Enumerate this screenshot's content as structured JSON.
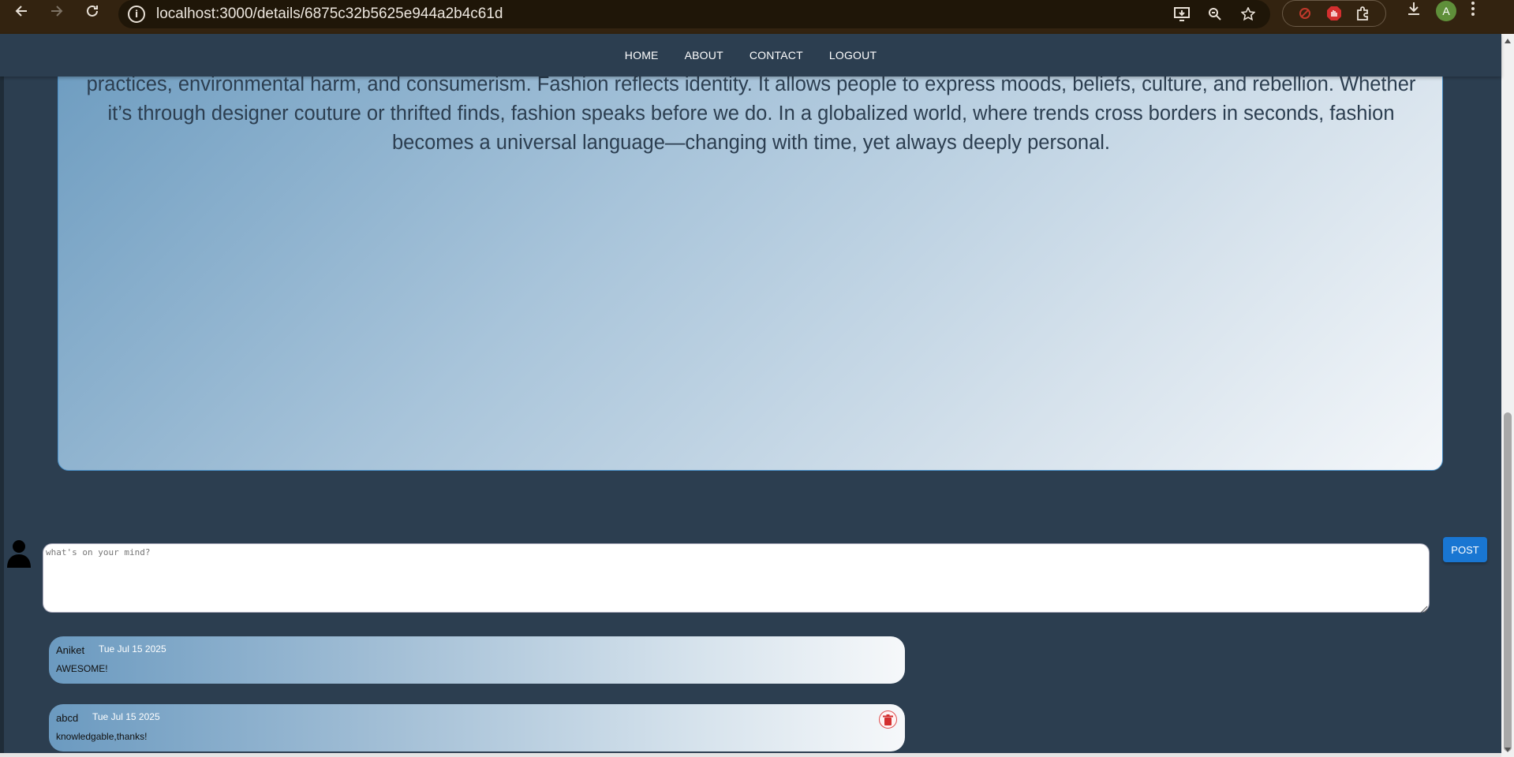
{
  "browser": {
    "url": "localhost:3000/details/6875c32b5625e944a2b4c61d",
    "profile_initial": "A"
  },
  "nav": {
    "items": [
      "HOME",
      "ABOUT",
      "CONTACT",
      "LOGOUT"
    ]
  },
  "article": {
    "lines": [
      "practices, environmental harm, and consumerism. Fashion reflects identity. It allows people to express moods, beliefs, culture, and rebellion. Whether",
      "it’s through designer couture or thrifted finds, fashion speaks before we do. In a globalized world, where trends cross borders in seconds, fashion",
      "becomes a universal language—changing with time, yet always deeply personal."
    ]
  },
  "composer": {
    "placeholder": "what's on your mind?",
    "post_label": "POST"
  },
  "comments": [
    {
      "author": "Aniket",
      "date": "Tue Jul 15 2025",
      "text": "AWESOME!",
      "deletable": false
    },
    {
      "author": "abcd",
      "date": "Tue Jul 15 2025",
      "text": "knowledgable,thanks!",
      "deletable": true
    }
  ],
  "colors": {
    "page_bg": "#2c3e50",
    "accent": "#1976d2",
    "delete": "#d32f2f"
  }
}
